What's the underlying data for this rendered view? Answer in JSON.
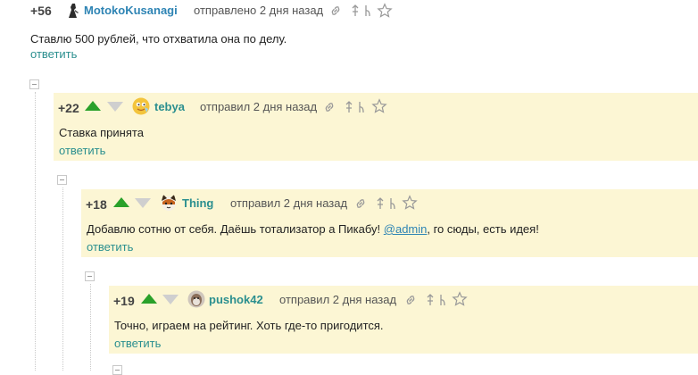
{
  "comments": [
    {
      "rating": "+56",
      "username": "MotokoKusanagi",
      "timestamp": "отправлено 2 дня назад",
      "text": "Ставлю 500 рублей, что отхватила она по делу.",
      "reply_label": "ответить"
    },
    {
      "rating": "+22",
      "username": "tebya",
      "timestamp": "отправил 2 дня назад",
      "text": "Ставка принята",
      "reply_label": "ответить"
    },
    {
      "rating": "+18",
      "username": "Thing",
      "timestamp": "отправил 2 дня назад",
      "text_before": "Добавлю сотню от себя. Даёшь тотализатор а Пикабу! ",
      "mention": "@admin",
      "text_after": ", го сюды, есть идея!",
      "reply_label": "ответить"
    },
    {
      "rating": "+19",
      "username": "pushok42",
      "timestamp": "отправил 2 дня назад",
      "text": "Точно, играем на рейтинг. Хоть где-то пригодится.",
      "reply_label": "ответить"
    }
  ],
  "colors": {
    "highlight_bg": "#fcf6d4",
    "vote_up": "#2aa12a",
    "vote_down": "#cfcfcf",
    "link": "#2b8f8f",
    "username_blue": "#2e84b4"
  },
  "icons": [
    "link-icon",
    "up-arrow-icon",
    "branch-icon",
    "star-icon"
  ]
}
